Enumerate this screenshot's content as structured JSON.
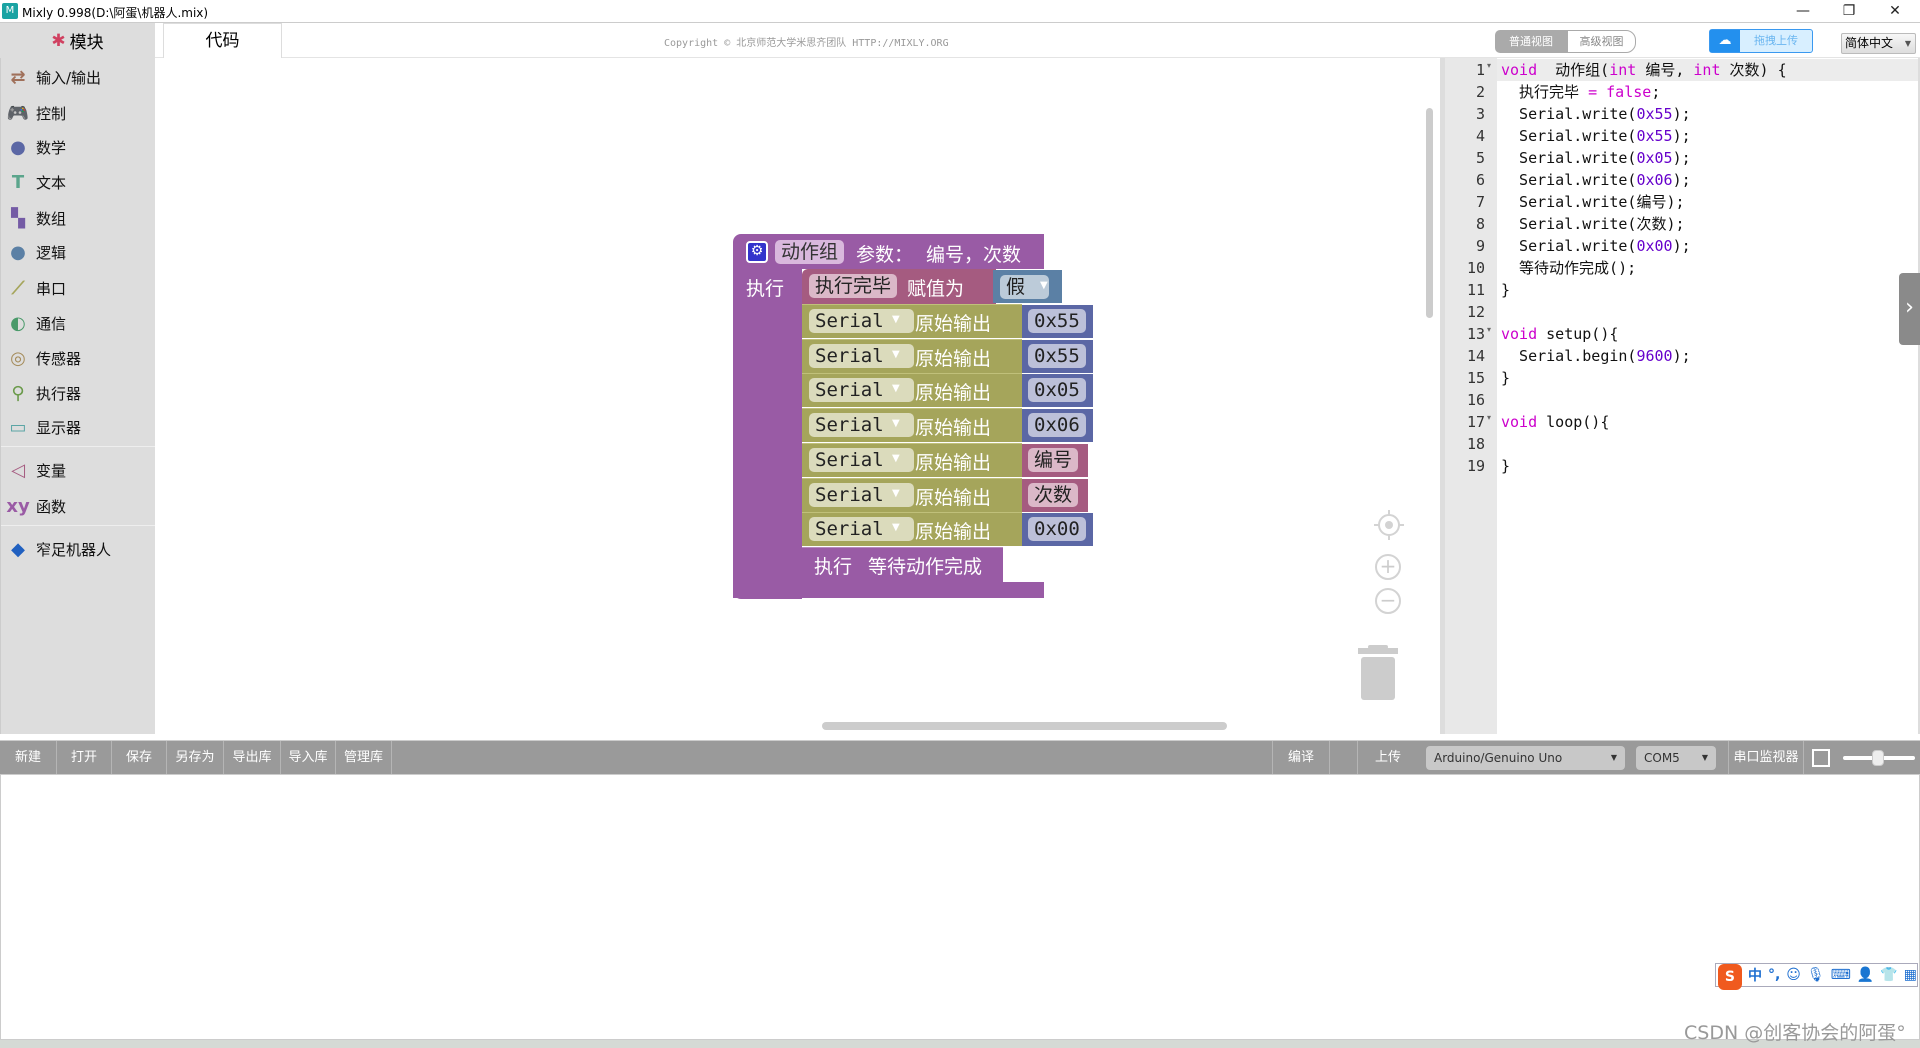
{
  "window": {
    "title": "Mixly 0.998(D:\\阿蛋\\机器人.mix)",
    "minimize": "—",
    "restore": "❐",
    "close": "✕"
  },
  "header": {
    "modules_tab": "模块",
    "code_tab": "代码",
    "copyright": "Copyright © 北京师范大学米思齐团队 HTTP://MIXLY.ORG",
    "normal_view": "普通视图",
    "advanced_view": "高级视图",
    "drag_upload": "拖拽上传",
    "language": "简体中文"
  },
  "sidebar": {
    "items": [
      {
        "label": "输入/输出",
        "icon": "arrows-icon",
        "color": "#a0705a"
      },
      {
        "label": "控制",
        "icon": "gamepad-icon",
        "color": "#5b9a5b"
      },
      {
        "label": "数学",
        "icon": "math-icon",
        "color": "#5b67a5"
      },
      {
        "label": "文本",
        "icon": "text-icon",
        "color": "#5ba58c"
      },
      {
        "label": "数组",
        "icon": "array-icon",
        "color": "#745ba5"
      },
      {
        "label": "逻辑",
        "icon": "bulb-icon",
        "color": "#5b80a5"
      },
      {
        "label": "串口",
        "icon": "usb-icon",
        "color": "#a5a55b"
      },
      {
        "label": "通信",
        "icon": "satellite-icon",
        "color": "#4a9a6a"
      },
      {
        "label": "传感器",
        "icon": "sensor-icon",
        "color": "#a58c5b"
      },
      {
        "label": "执行器",
        "icon": "actuator-icon",
        "color": "#6a9a4a"
      },
      {
        "label": "显示器",
        "icon": "monitor-icon",
        "color": "#5ba5a5"
      },
      {
        "label": "变量",
        "icon": "variable-icon",
        "color": "#a55b80"
      },
      {
        "label": "函数",
        "icon": "function-icon",
        "color": "#9a5ba5"
      },
      {
        "label": "窄足机器人",
        "icon": "cube-icon",
        "color": "#2060c0"
      }
    ]
  },
  "workspace": {
    "procedure": {
      "name": "动作组",
      "params_label": "参数：",
      "params": "编号，次数",
      "do_label": "执行"
    },
    "assign": {
      "var": "执行完毕",
      "label": "赋值为",
      "value": "假"
    },
    "serial_rows": [
      {
        "port": "Serial",
        "label": "原始输出",
        "value": "0x55",
        "kind": "hex"
      },
      {
        "port": "Serial",
        "label": "原始输出",
        "value": "0x55",
        "kind": "hex"
      },
      {
        "port": "Serial",
        "label": "原始输出",
        "value": "0x05",
        "kind": "hex"
      },
      {
        "port": "Serial",
        "label": "原始输出",
        "value": "0x06",
        "kind": "hex"
      },
      {
        "port": "Serial",
        "label": "原始输出",
        "value": "编号",
        "kind": "var"
      },
      {
        "port": "Serial",
        "label": "原始输出",
        "value": "次数",
        "kind": "var"
      },
      {
        "port": "Serial",
        "label": "原始输出",
        "value": "0x00",
        "kind": "hex"
      }
    ],
    "call": {
      "label": "执行",
      "name": "等待动作完成"
    },
    "colors": {
      "procedure": "#995ba5",
      "variable": "#a55b80",
      "logic": "#5b80a5",
      "serial": "#a5a55b",
      "math": "#5b67a5"
    }
  },
  "code": {
    "lines": [
      [
        [
          "kw",
          "void"
        ],
        [
          "",
          "  动作组("
        ],
        [
          "kw",
          "int"
        ],
        [
          "",
          " 编号, "
        ],
        [
          "kw",
          "int"
        ],
        [
          "",
          " 次数) {"
        ]
      ],
      [
        [
          "",
          "  执行完毕 "
        ],
        [
          "kw",
          "= false"
        ],
        [
          "",
          ";"
        ]
      ],
      [
        [
          "",
          "  Serial.write("
        ],
        [
          "num",
          "0x55"
        ],
        [
          "",
          ");"
        ]
      ],
      [
        [
          "",
          "  Serial.write("
        ],
        [
          "num",
          "0x55"
        ],
        [
          "",
          ");"
        ]
      ],
      [
        [
          "",
          "  Serial.write("
        ],
        [
          "num",
          "0x05"
        ],
        [
          "",
          ");"
        ]
      ],
      [
        [
          "",
          "  Serial.write("
        ],
        [
          "num",
          "0x06"
        ],
        [
          "",
          ");"
        ]
      ],
      [
        [
          "",
          "  Serial.write(编号);"
        ]
      ],
      [
        [
          "",
          "  Serial.write(次数);"
        ]
      ],
      [
        [
          "",
          "  Serial.write("
        ],
        [
          "num",
          "0x00"
        ],
        [
          "",
          ");"
        ]
      ],
      [
        [
          "",
          "  等待动作完成();"
        ]
      ],
      [
        [
          "",
          "}"
        ]
      ],
      [],
      [
        [
          "kw",
          "void"
        ],
        [
          "",
          " setup(){"
        ]
      ],
      [
        [
          "",
          "  Serial.begin("
        ],
        [
          "num",
          "9600"
        ],
        [
          "",
          ");"
        ]
      ],
      [
        [
          "",
          "}"
        ]
      ],
      [],
      [
        [
          "kw",
          "void"
        ],
        [
          "",
          " loop(){"
        ]
      ],
      [],
      [
        [
          "",
          "}"
        ]
      ]
    ],
    "fold_lines": [
      1,
      13,
      17
    ]
  },
  "toolbar": {
    "new": "新建",
    "open": "打开",
    "save": "保存",
    "save_as": "另存为",
    "export_lib": "导出库",
    "import_lib": "导入库",
    "manage_lib": "管理库",
    "compile": "编译",
    "upload": "上传",
    "board": "Arduino/Genuino Uno",
    "port": "COM5",
    "serial_monitor": "串口监视器"
  },
  "ime": {
    "logo": "S",
    "mode": "中",
    "punct": "°,"
  },
  "watermark": "CSDN @创客协会的阿蛋°"
}
